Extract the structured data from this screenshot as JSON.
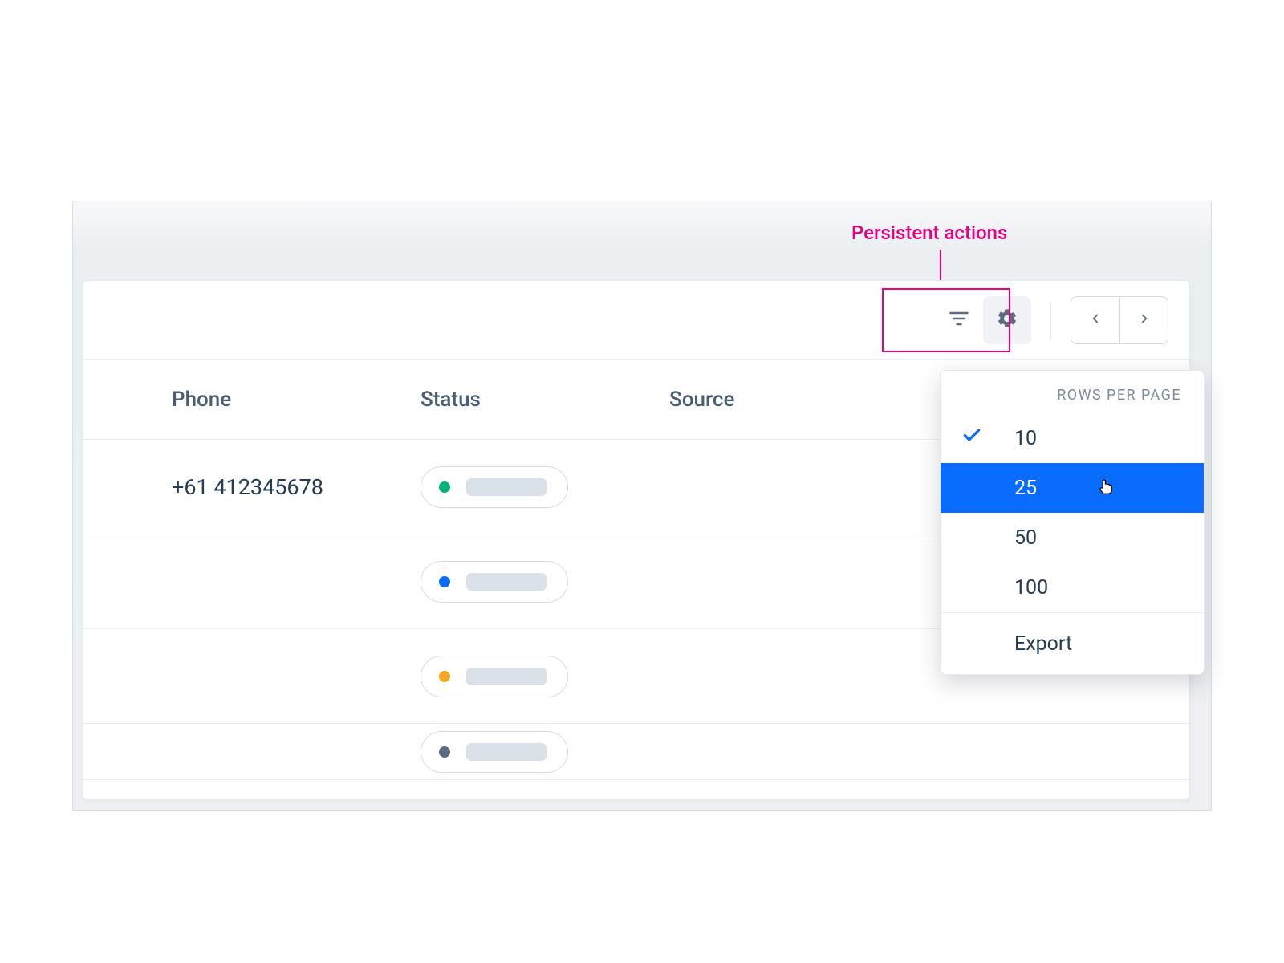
{
  "annotation": {
    "label": "Persistent actions"
  },
  "table": {
    "headers": {
      "phone": "Phone",
      "status": "Status",
      "source": "Source"
    },
    "rows": [
      {
        "phone": "+61 412345678",
        "status_color": "green"
      },
      {
        "phone": "",
        "status_color": "blue"
      },
      {
        "phone": "",
        "status_color": "amber"
      },
      {
        "phone": "",
        "status_color": "slate"
      }
    ]
  },
  "popover": {
    "header": "ROWS PER PAGE",
    "options": [
      "10",
      "25",
      "50",
      "100"
    ],
    "selected_index": 0,
    "hover_index": 1,
    "export_label": "Export"
  },
  "colors": {
    "accent_pink": "#E6007E",
    "accent_blue": "#0a6cff"
  }
}
